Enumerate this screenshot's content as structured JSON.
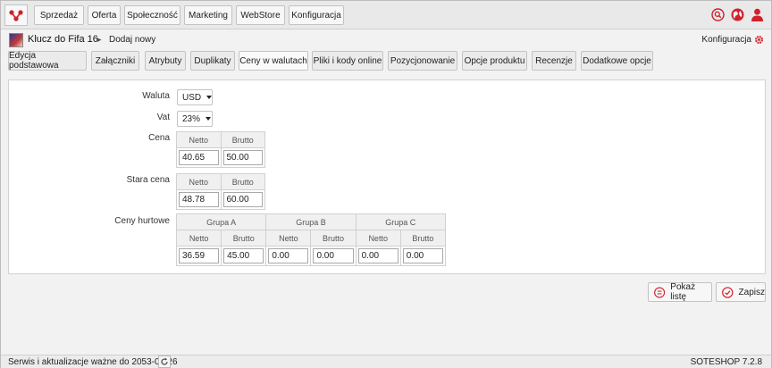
{
  "topnav": {
    "items": [
      "Sprzedaż",
      "Oferta",
      "Społeczność",
      "Marketing",
      "WebStore",
      "Konfiguracja"
    ],
    "icons": [
      "search-icon",
      "globe-icon",
      "user-icon"
    ],
    "accent": "#d0202c"
  },
  "breadcrumb": {
    "title": "Klucz do Fifa 16",
    "separator": "▸",
    "current": "Dodaj nowy",
    "config_label": "Konfiguracja"
  },
  "tabs": [
    "Edycja podstawowa",
    "Załączniki",
    "Atrybuty",
    "Duplikaty",
    "Ceny w walutach",
    "Pliki i kody online",
    "Pozycjonowanie",
    "Opcje produktu",
    "Recenzje",
    "Dodatkowe opcje"
  ],
  "active_tab": "Ceny w walutach",
  "form": {
    "waluta_label": "Waluta",
    "waluta_value": "USD",
    "vat_label": "Vat",
    "vat_value": "23%",
    "cena_label": "Cena",
    "netto_header": "Netto",
    "brutto_header": "Brutto",
    "cena_netto": "40.65",
    "cena_brutto": "50.00",
    "stara_cena_label": "Stara cena",
    "stara_netto": "48.78",
    "stara_brutto": "60.00",
    "ceny_hurtowe_label": "Ceny hurtowe",
    "groups": [
      {
        "name": "Grupa A",
        "netto": "36.59",
        "brutto": "45.00"
      },
      {
        "name": "Grupa B",
        "netto": "0.00",
        "brutto": "0.00"
      },
      {
        "name": "Grupa C",
        "netto": "0.00",
        "brutto": "0.00"
      }
    ]
  },
  "actions": {
    "show_list": "Pokaż listę",
    "save": "Zapisz"
  },
  "footer": {
    "service_text": "Serwis i aktualizacje ważne do 2053-08-26",
    "version": "SOTESHOP 7.2.8"
  }
}
